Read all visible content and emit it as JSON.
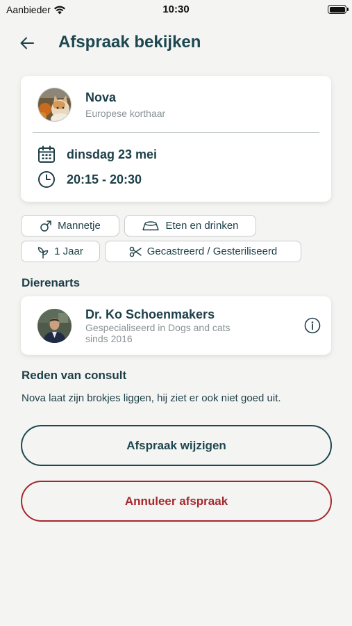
{
  "status_bar": {
    "carrier": "Aanbieder",
    "time": "10:30"
  },
  "header": {
    "title": "Afspraak bekijken"
  },
  "pet": {
    "name": "Nova",
    "breed": "Europese korthaar",
    "date": "dinsdag 23 mei",
    "time": "20:15 - 20:30"
  },
  "tags": {
    "gender": "Mannetje",
    "food": "Eten en drinken",
    "age": "1 Jaar",
    "neutered": "Gecastreerd / Gesteriliseerd"
  },
  "vet": {
    "section_title": "Dierenarts",
    "name": "Dr. Ko Schoenmakers",
    "specialty_line1": "Gespecialiseerd in Dogs and cats",
    "specialty_line2": "sinds 2016"
  },
  "reason": {
    "section_title": "Reden van consult",
    "text": "Nova laat zijn brokjes liggen, hij ziet er ook niet goed uit."
  },
  "actions": {
    "change_label": "Afspraak wijzigen",
    "cancel_label": "Annuleer afspraak"
  },
  "colors": {
    "primary": "#1d4750",
    "danger": "#a5282d",
    "background": "#f4f4f2",
    "muted_text": "#8a9396"
  }
}
